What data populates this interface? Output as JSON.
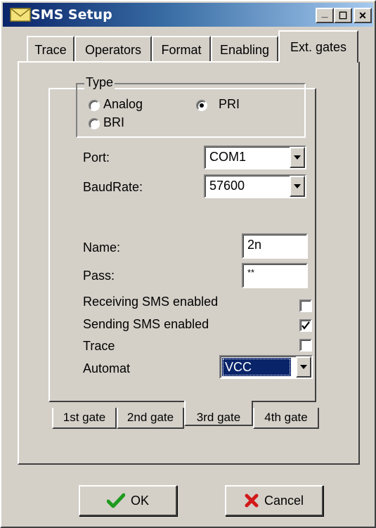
{
  "window": {
    "title": "SMS Setup",
    "minimize_glyph": "_",
    "maximize_glyph": "☐",
    "close_glyph": "✕"
  },
  "tabs": [
    {
      "label": "Trace"
    },
    {
      "label": "Operators"
    },
    {
      "label": "Format"
    },
    {
      "label": "Enabling"
    },
    {
      "label": "Ext. gates"
    }
  ],
  "active_tab": "Ext. gates",
  "type_group": {
    "legend": "Type",
    "options": [
      {
        "label": "Analog",
        "checked": false
      },
      {
        "label": "PRI",
        "checked": true
      },
      {
        "label": "BRI",
        "checked": false
      }
    ]
  },
  "port": {
    "label": "Port:",
    "value": "COM1"
  },
  "baudrate": {
    "label": "BaudRate:",
    "value": "57600"
  },
  "name": {
    "label": "Name:",
    "value": "2n"
  },
  "pass": {
    "label": "Pass:",
    "value": "**"
  },
  "receiving": {
    "label": "Receiving SMS enabled",
    "checked": false
  },
  "sending": {
    "label": "Sending SMS enabled",
    "checked": true
  },
  "trace": {
    "label": "Trace",
    "checked": false
  },
  "automat": {
    "label": "Automat",
    "value": "VCC"
  },
  "gate_tabs": [
    {
      "label": "1st gate"
    },
    {
      "label": "2nd gate"
    },
    {
      "label": "3rd gate"
    },
    {
      "label": "4th gate"
    }
  ],
  "active_gate": "3rd gate",
  "buttons": {
    "ok": "OK",
    "cancel": "Cancel"
  },
  "colors": {
    "face": "#d4d0c8",
    "title_start": "#0a246a",
    "title_end": "#a6caf0",
    "selection": "#0a246a",
    "ok_icon": "#1f9a1f",
    "cancel_icon": "#d21a1a"
  }
}
